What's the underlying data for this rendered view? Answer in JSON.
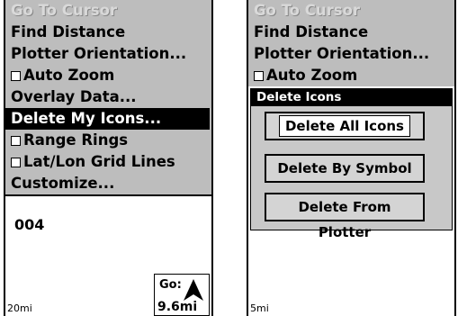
{
  "left_screen": {
    "menu": [
      {
        "label": "Go To Cursor",
        "state": "disabled",
        "checkbox": false
      },
      {
        "label": "Find Distance",
        "state": "normal",
        "checkbox": false
      },
      {
        "label": "Plotter Orientation...",
        "state": "normal",
        "checkbox": false
      },
      {
        "label": "Auto Zoom",
        "state": "normal",
        "checkbox": true
      },
      {
        "label": "Overlay Data...",
        "state": "normal",
        "checkbox": false
      },
      {
        "label": "Delete My Icons...",
        "state": "selected",
        "checkbox": false
      },
      {
        "label": "Range Rings",
        "state": "normal",
        "checkbox": true
      },
      {
        "label": "Lat/Lon Grid Lines",
        "state": "normal",
        "checkbox": true
      },
      {
        "label": "Customize...",
        "state": "normal",
        "checkbox": false
      }
    ],
    "waypoint_label": "004",
    "scale": "20mi",
    "go_box": {
      "label": "Go:",
      "value": "9.6mi",
      "icon": "north-arrow-icon"
    }
  },
  "right_screen": {
    "menu": [
      {
        "label": "Go To Cursor",
        "state": "disabled",
        "checkbox": false
      },
      {
        "label": "Find Distance",
        "state": "normal",
        "checkbox": false
      },
      {
        "label": "Plotter Orientation...",
        "state": "normal",
        "checkbox": false
      },
      {
        "label": "Auto Zoom",
        "state": "normal",
        "checkbox": true
      }
    ],
    "popup": {
      "title": "Delete Icons",
      "buttons": [
        {
          "label": "Delete All Icons",
          "focused": true
        },
        {
          "label": "Delete By Symbol",
          "focused": false
        },
        {
          "label": "Delete From Plotter",
          "focused": false
        }
      ]
    },
    "scale": "5mi"
  }
}
